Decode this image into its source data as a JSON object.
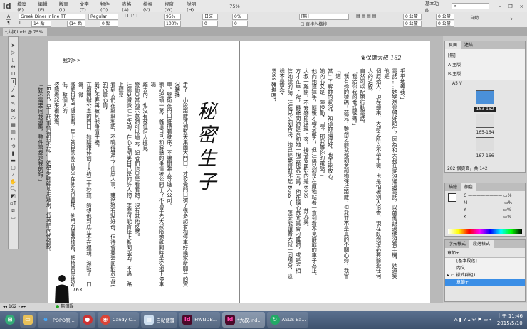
{
  "app": {
    "logo": "Id",
    "menu": [
      "檔案(F)",
      "編輯(E)",
      "版面(L)",
      "文字(T)",
      "物件(O)",
      "表格(A)",
      "檢視(V)",
      "視窗(W)",
      "說明(H)"
    ],
    "zoom": "75%",
    "workspace": "基本功能",
    "window_controls": [
      "–",
      "❐",
      "×"
    ]
  },
  "control": {
    "font": "Greek Diner Inline TT",
    "style": "Regular",
    "size": "14 點",
    "leading": "(14 點",
    "kerning": "0 點",
    "vscale": "95%",
    "hscale": "100%",
    "lang": "日文",
    "tracking": "0%",
    "baseline": "0",
    "tsume": "0",
    "mojikumi": "[無]",
    "checkbox_label": "直排內橫排",
    "indent_left": "0 公釐",
    "indent_right": "0 公釐",
    "space_before": "0 公釐",
    "space_after": "0 公釐",
    "auto": "自動"
  },
  "document": {
    "tab": "*大叔.indd @ 75%",
    "tab_close": "×"
  },
  "left_page": {
    "header": "我的>>",
    "title": "秘密生子",
    "page_number": "163",
    "columns": [
      "走了一小段距離才到藍天集團大門口，才發覺門口擠了很多記者和停車好幾家新聞台的實況轉播",
      "車。警衛在門口維持著秩序，不讓閒雜人等進入公司。",
      "她心裡頭一驚，難道自己和爵爺的事情被公開了？不過早先大叔陪她離開時是從地下停車場",
      "離去的，也沒有被任何人撞見。",
      "警衛只當她示意她可以過去，記者們也只是看看她，沒有其他反應。",
      "汪蘊兒微微吐吐舌頭，在心底嘲笑自己是何許人物，怎麼可能會扯上新聞版面，不過一路上總是",
      "看到人們在竊竊私語，不曉得發生了什麼大事，雖然她有點好奇，但待會要去面對苏亢昊的沉重心情，",
      "最好不要再被其他事情干擾。",
      "在顧問辦公室的門口，她躊躇徘徊了大約二十秒鐘，猜想他到底在不在裡頭，深吸了一口氣，微",
      "微顫抖的門縫偷看，馬上就見到苏亢昊坐在他的位置裡，他用力靠著椅背，把椅背壓地好低，整個人的",
      "姿態看起來很疲憊。",
      "「Boss，早上的事情很對不起。」她舉步翩翩地走進來，低著頭向他致歉。",
      "「妳不需要向我道歉，整件事都是我的錯。」"
    ]
  },
  "right_page": {
    "header": "保鑣大叔",
    "page_number": "162",
    "columns": [
      "乎乎地等我。」",
      "電話……她突然覺得好陌生，因為和大叔在從沒通過電話，以前他說過他沒有手機，她還笑他是",
      "個原始人，現在想來，大叔之所以不帶手機，也是怕被別人追查，現在既然沒必要躲避任何人的追殺，",
      "自然可以配帶行動電話。",
      "「我給你我的電話號碼。」",
      "「我有妳的號碼！蘊兒，雖然之前我都刻意和妳保持距離，但我並不是真的不關心妳，我會『適",
      "當』了解妳的狀況，知道妳過得好，我才能放心。」",
      "她內心又是一陣悸動，「噢，那我等你的電話。」",
      "他向她揮揮手，隨後才轉身離去，但汪蘊兒卻是在原地站著一直到看不見爵爺的車子為止。",
      "大叔一離開，不安感即浮現上來，接著要面對的是 Boss——苏亢昊。",
      "方才在車子裡，爵爺問她是否和她一塊去找苏亢昊，他在擔心苏亢昊會刁難她，或是不相",
      "信她說的話，汪蘊兒立刻否決，她已經覺得對不起 Boss 了，怎麼能讓著大叔一同現身，這樣不是更令",
      "Boss 難堪嗎？"
    ]
  },
  "pages_panel": {
    "tabs": [
      "頁面",
      "連結"
    ],
    "masters": [
      "[無]",
      "A-主版",
      "B-主版"
    ],
    "size": "A5 V",
    "spreads": [
      "163-162",
      "165-164",
      "167-166"
    ],
    "footer": "282 個頁面，共 142"
  },
  "color_panel": {
    "tabs": [
      "描繪",
      "顏色"
    ],
    "channels": [
      "C",
      "M",
      "Y",
      "K"
    ],
    "unit": "%"
  },
  "para_panel": {
    "tabs": [
      "字元樣式",
      "段落樣式"
    ],
    "current": "章節+",
    "items": [
      "[基本段落]",
      "內文",
      "樣式群組1",
      "章節+"
    ]
  },
  "status": {
    "page": "162",
    "preflight": "無錯誤"
  },
  "taskbar": {
    "items": [
      "POPO原...",
      "Candy C...",
      "自黏便箋",
      "HWNDB...",
      "*大叔.ind...",
      "ASUS Ea..."
    ],
    "time": "上午 11:46",
    "date": "2015/5/10"
  }
}
